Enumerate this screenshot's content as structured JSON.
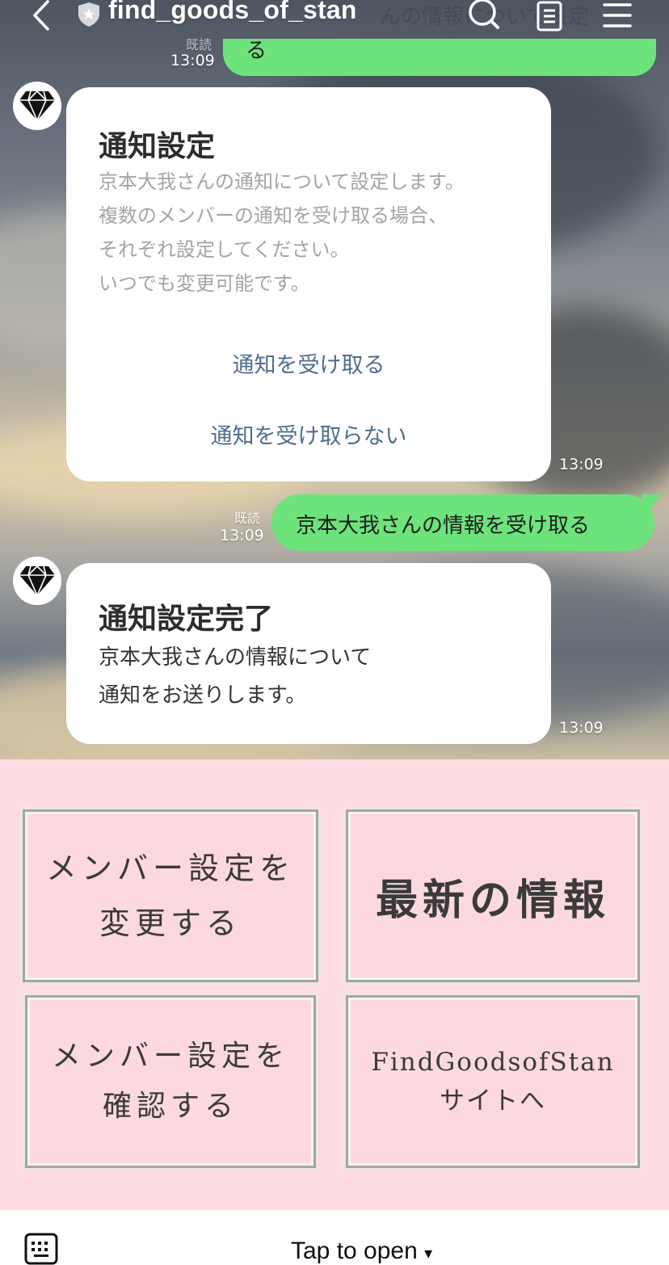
{
  "header": {
    "title": "find_goods_of_stan",
    "ghost_text": "んの情報について設定",
    "icons": [
      "back-chevron-icon",
      "shield-star-icon",
      "search-icon",
      "notes-icon",
      "menu-icon"
    ]
  },
  "messages": {
    "top_partial": {
      "time": "13:09",
      "read": "既読",
      "text": "る"
    },
    "settings_card": {
      "title": "通知設定",
      "desc": "京本大我さんの通知について設定します。\n複数のメンバーの通知を受け取る場合、\nそれぞれ設定してください。\nいつでも変更可能です。",
      "option_receive": "通知を受け取る",
      "option_decline": "通知を受け取らない",
      "time": "13:09"
    },
    "user_reply": {
      "read": "既読",
      "time": "13:09",
      "text": "京本大我さんの情報を受け取る"
    },
    "complete_card": {
      "title": "通知設定完了",
      "body": "京本大我さんの情報について\n通知をお送りします。",
      "time": "13:09"
    }
  },
  "rich_menu": {
    "change_member": "メンバー設定を\n変更する",
    "latest_info": "最新の情報",
    "confirm_member": "メンバー設定を\n確認する",
    "site_link": "FindGoodsofStan\nサイトへ"
  },
  "bottom": {
    "tap_label": "Tap to open",
    "caret": "▾",
    "keyboard_icon": "keyboard-icon"
  },
  "colors": {
    "bubble_green": "#6de37c",
    "rich_menu_bg": "#fddde3",
    "link_blue": "#4f6d8d"
  }
}
